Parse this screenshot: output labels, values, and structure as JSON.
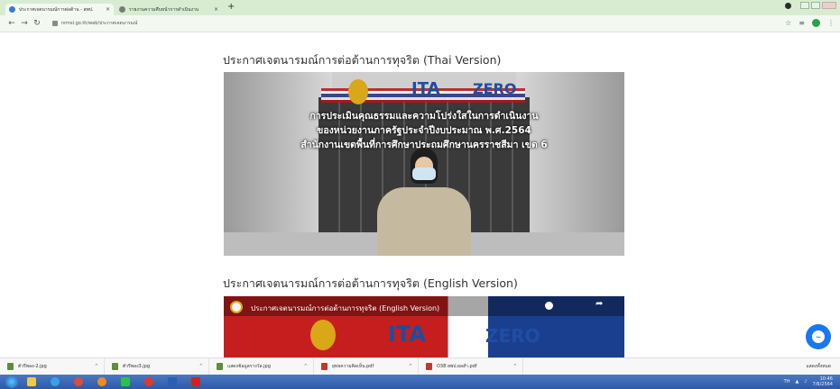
{
  "browser": {
    "tabs": [
      {
        "title": "ประกาศเจตนารมณ์การต่อต้าน - สพป.",
        "favicon_color": "#3a7bd5",
        "active": true
      },
      {
        "title": "รายงานความคืบหน้าการดำเนินงาน",
        "favicon_color": "#7a7a7a",
        "active": false
      }
    ],
    "new_tab": "+",
    "url": "nrmsl.go.th/web/ประกาศเจตนารมณ์"
  },
  "page": {
    "heading_thai": "ประกาศเจตนารมณ์การต่อต้านการทุจริต (Thai Version)",
    "heading_english": "ประกาศเจตนารมณ์การต่อต้านการทุจริต (English Version)",
    "video1": {
      "ita_logo": "ITA",
      "zero_logo": "ZERO",
      "overlay_line1": "การประเมินคุณธรรมและความโปร่งใสในการดำเนินงาน",
      "overlay_line2": "ของหน่วยงานภาครัฐประจำปีงบประมาณ พ.ศ.2564",
      "overlay_line3": "สำนักงานเขตพื้นที่การศึกษาประถมศึกษานครราชสีมา เขต 6"
    },
    "video2": {
      "title": "ประกาศเจตนารมณ์การต่อต้านการทุจริต (English Version)",
      "ita_logo": "ITA",
      "zero_logo": "ZERO"
    }
  },
  "downloads": {
    "items": [
      {
        "name": "ตัวรีพลง-2.jpg",
        "icon_color": "#5b8f3a"
      },
      {
        "name": "ตัวรีพลง3.jpg",
        "icon_color": "#5b8f3a"
      },
      {
        "name": "แสดงข้อมูลรางวัล.jpg",
        "icon_color": "#5b8f3a"
      },
      {
        "name": "ยุทธความคิดเห็น.pdf",
        "icon_color": "#c0392b"
      },
      {
        "name": "O38 สพป.ผลสำ.pdf",
        "icon_color": "#c0392b"
      }
    ],
    "show_all": "แสดงทั้งหมด"
  },
  "taskbar": {
    "apps": [
      {
        "name": "explorer",
        "color": "#f0c84a"
      },
      {
        "name": "media",
        "color": "#3aa0e8"
      },
      {
        "name": "chrome",
        "color": "#e04b3a"
      },
      {
        "name": "firefox",
        "color": "#f28a1c"
      },
      {
        "name": "line",
        "color": "#2ac34a"
      },
      {
        "name": "chrome2",
        "color": "#dd3b2a"
      },
      {
        "name": "word",
        "color": "#2b5fb4"
      },
      {
        "name": "acrobat",
        "color": "#d42020"
      }
    ],
    "lang": "TH",
    "time": "10:46",
    "date": "7/6/2564"
  }
}
